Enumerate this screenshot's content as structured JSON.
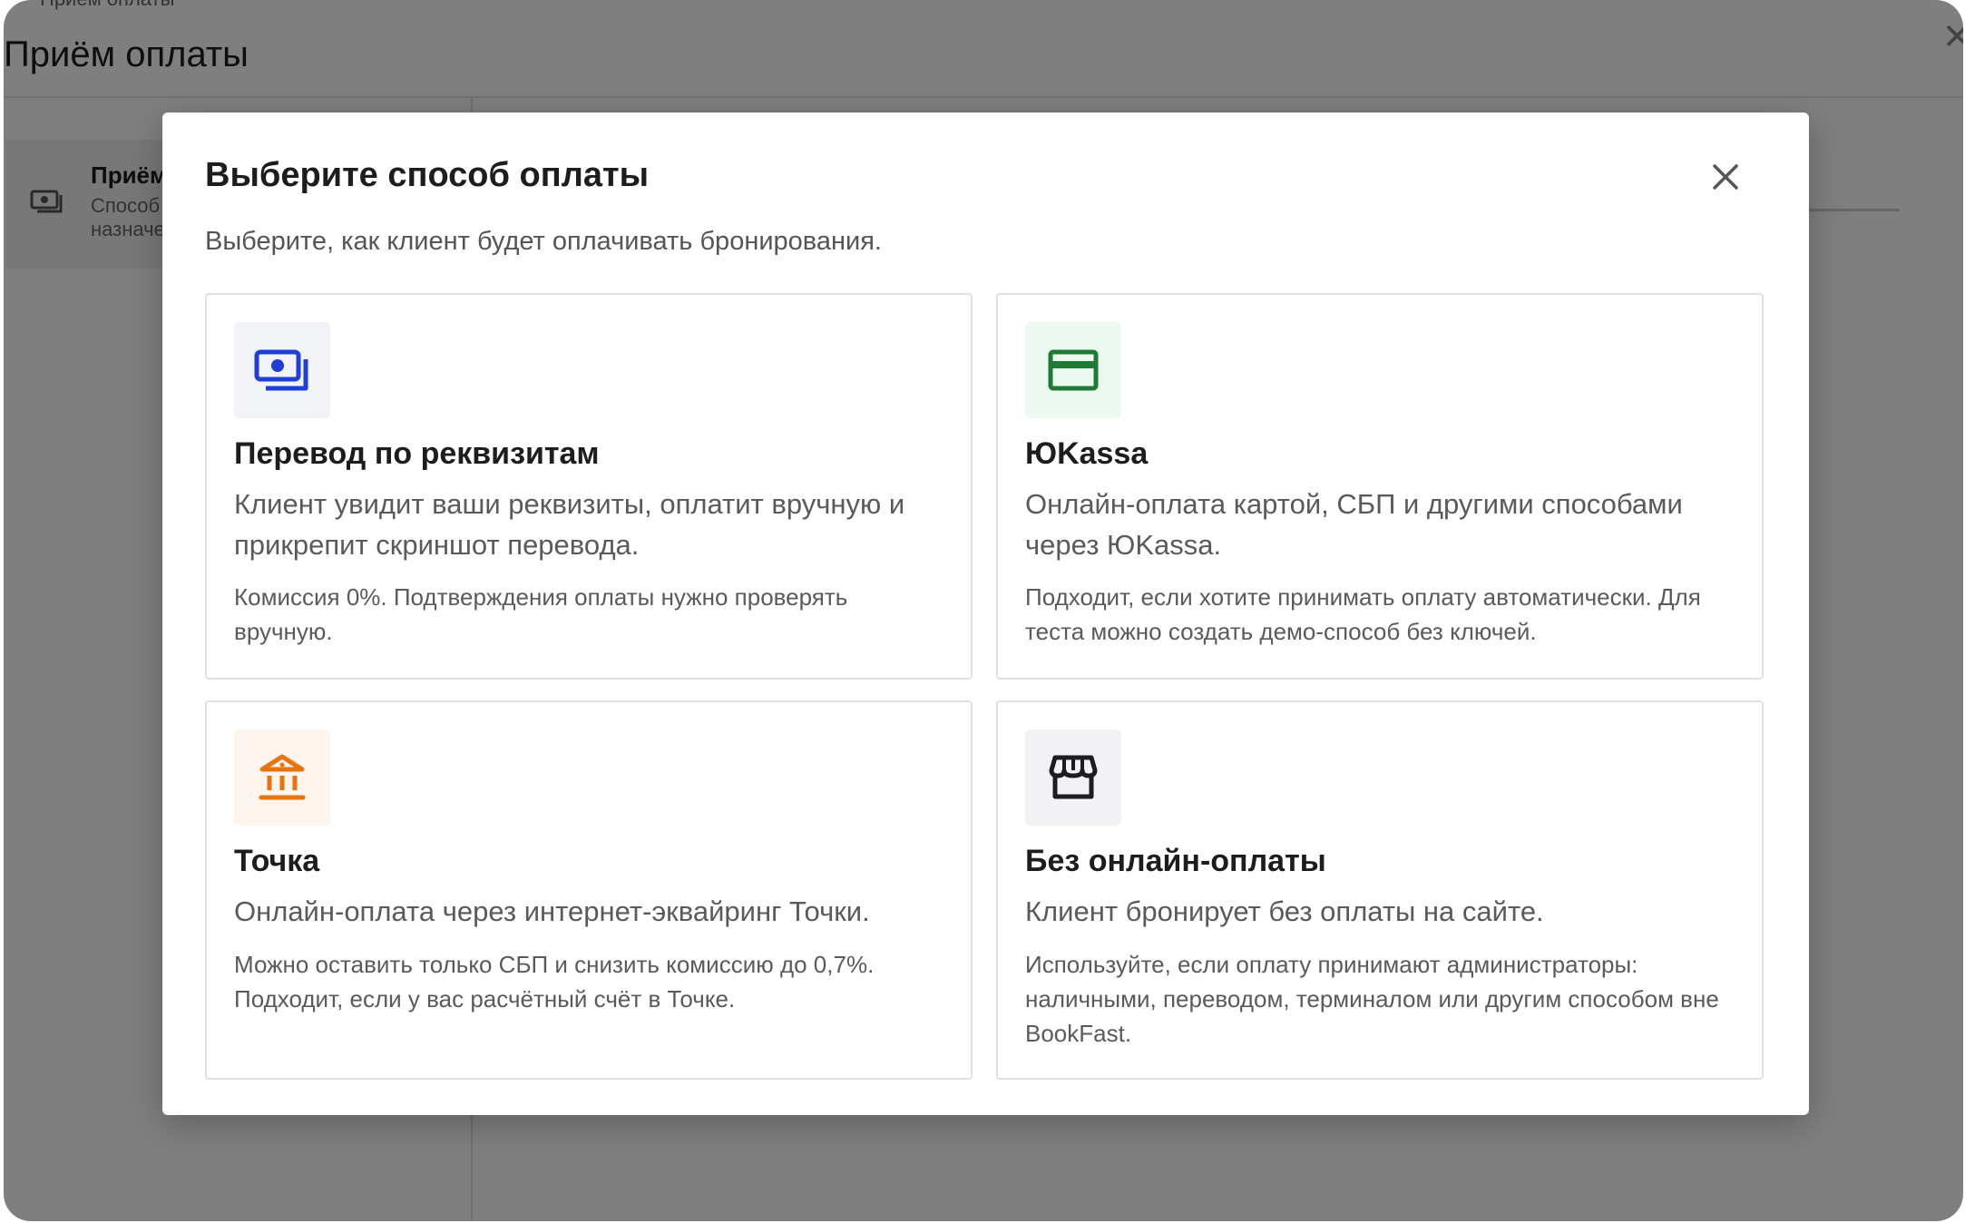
{
  "background": {
    "breadcrumb": "Приём оплаты",
    "page_title": "Приём оплаты",
    "sidebar_item_title": "Приём",
    "sidebar_item_subtitle": "Способ назначе"
  },
  "modal": {
    "title": "Выберите способ оплаты",
    "subtitle": "Выберите, как клиент будет оплачивать бронирования.",
    "options": [
      {
        "icon": "cash-icon",
        "accent_color": "#1f3fd6",
        "icon_bg": "#f2f3f7",
        "title": "Перевод по реквизитам",
        "description": "Клиент увидит ваши реквизиты, оплатит вручную и прикрепит скриншот перевода.",
        "note": "Комиссия 0%. Подтверждения оплаты нужно проверять вручную."
      },
      {
        "icon": "credit-card-icon",
        "accent_color": "#1f7a35",
        "icon_bg": "#edf9f0",
        "title": "ЮKassa",
        "description": "Онлайн-оплата картой, СБП и другими способами через ЮKassa.",
        "note": "Подходит, если хотите принимать оплату автоматически. Для теста можно создать демо-способ без ключей."
      },
      {
        "icon": "bank-icon",
        "accent_color": "#e8740f",
        "icon_bg": "#fdf5ee",
        "title": "Точка",
        "description": "Онлайн-оплата через интернет-эквайринг Точки.",
        "note": "Можно оставить только СБП и снизить комиссию до 0,7%. Подходит, если у вас расчётный счёт в Точке."
      },
      {
        "icon": "storefront-icon",
        "accent_color": "#1d1d1f",
        "icon_bg": "#f2f2f4",
        "title": "Без онлайн-оплаты",
        "description": "Клиент бронирует без оплаты на сайте.",
        "note": "Используйте, если оплату принимают администраторы: наличными, переводом, терминалом или другим способом вне BookFast."
      }
    ]
  }
}
